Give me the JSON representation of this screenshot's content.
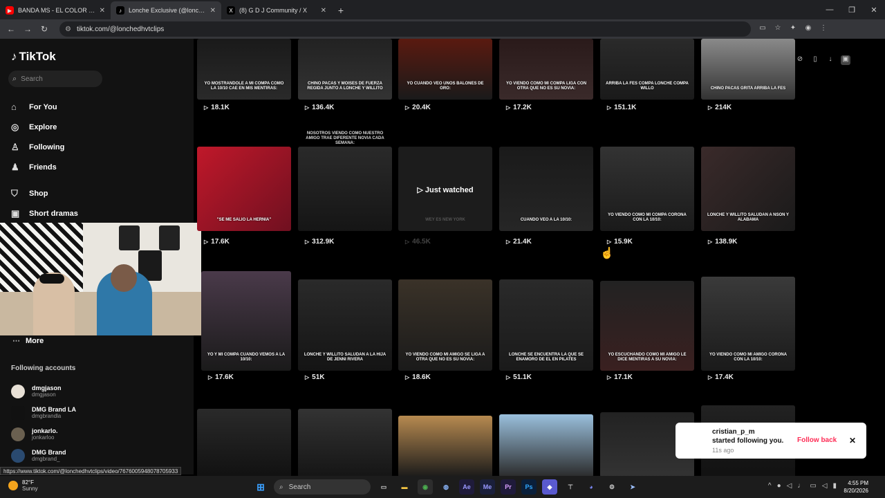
{
  "browser": {
    "tabs": [
      {
        "title": "BANDA MS - EL COLOR DE TUS",
        "favicon_color": "#ff0000"
      },
      {
        "title": "Lonche Exclusive (@lonchedhvtclips)",
        "favicon_color": "#000000"
      },
      {
        "title": "(8) G D J Community / X",
        "favicon_color": "#000000"
      }
    ],
    "url": "tiktok.com/@lonchedhvtclips"
  },
  "sidebar": {
    "logo": "TikTok",
    "search_placeholder": "Search",
    "menu": [
      {
        "label": "For You",
        "icon": "home-icon"
      },
      {
        "label": "Explore",
        "icon": "compass-icon"
      },
      {
        "label": "Following",
        "icon": "following-icon"
      },
      {
        "label": "Friends",
        "icon": "friends-icon"
      },
      {
        "label": "Shop",
        "icon": "shop-icon"
      },
      {
        "label": "Short dramas",
        "icon": "drama-icon"
      }
    ],
    "more": "More",
    "following_title": "Following accounts",
    "accounts": [
      {
        "name": "dmgjason",
        "handle": "dmgjason"
      },
      {
        "name": "DMG Brand LA",
        "handle": "dmgbrandla"
      },
      {
        "name": "jonkarlo.",
        "handle": "jonkarloo"
      },
      {
        "name": "DMG Brand",
        "handle": "dmgbrand_"
      }
    ]
  },
  "videos": {
    "row1": [
      {
        "caption": "YO MOSTRANDOLE A MI COMPA COMO LA 10/10 CAE EN MIS MENTIRAS:",
        "views": "18.1K"
      },
      {
        "caption": "CHINO PACAS Y MOISES DE FUERZA REGIDA JUNTO A LONCHE Y WILLITO",
        "views": "136.4K"
      },
      {
        "caption": "YO CUANDO VEO UNOS BALONES DE ORO:",
        "views": "20.4K"
      },
      {
        "caption": "YO VIENDO COMO MI COMPA LIGA CON OTRA QUE NO ES SU NOVIA:",
        "views": "17.2K"
      },
      {
        "caption": "ARRIBA LA FES COMPA LONCHE COMPA WILLO",
        "views": "151.1K"
      },
      {
        "caption": "CHINO PACAS GRITA ARRIBA LA FES",
        "views": "214K"
      }
    ],
    "row2": [
      {
        "caption": "\"SE ME SALIO LA HERNIA\"",
        "views": "17.6K"
      },
      {
        "caption": "NOSOTROS VIENDO COMO NUESTRO AMIGO TRAE DIFERENTE NOVIA CADA SEMANA:",
        "views": "312.9K"
      },
      {
        "caption": "WEY ES NEW YORK",
        "views": "46.5K",
        "watched": "Just watched"
      },
      {
        "caption": "CUANDO VEO A LA 10/10:",
        "views": "21.4K"
      },
      {
        "caption": "YO VIENDO COMO MI COMPA CORONA CON LA 10/10:",
        "views": "15.9K"
      },
      {
        "caption": "LONCHE Y WILLITO SALUDAN A NSON Y ALABAMA",
        "views": "138.9K"
      }
    ],
    "row3": [
      {
        "caption": "YO Y MI COMPA CUANDO VEMOS A LA 10/10:",
        "views": "17.6K"
      },
      {
        "caption": "LONCHE Y WILLITO SALUDAN A LA HIJA DE JENNI RIVERA",
        "views": "51K"
      },
      {
        "caption": "YO VIENDO COMO MI AMIGO SE LIGA A OTRA QUE NO ES SU NOVIA:",
        "views": "18.6K"
      },
      {
        "caption": "LONCHE SE ENCUENTRA LA QUE SE ENAMORO DE EL EN PILATES",
        "views": "51.1K"
      },
      {
        "caption": "YO ESCUCHANDO COMO MI AMIGO LE DICE MENTIRAS A SU NOVIA:",
        "views": "17.1K"
      },
      {
        "caption": "YO VIENDO COMO MI AMIGO CORONA CON LA 10/10:",
        "views": "17.4K"
      }
    ]
  },
  "notification": {
    "user": "cristian_p_m",
    "message": "started following you.",
    "time": "11s ago",
    "action": "Follow back"
  },
  "status_url": "https://www.tiktok.com/@lonchedhvtclips/video/7676005948078705933",
  "taskbar": {
    "temp": "82°F",
    "condition": "Sunny",
    "search": "Search",
    "time": "4:55 PM",
    "date": "8/20/2026"
  },
  "colors": {
    "accent": "#fe2c55",
    "background": "#000000"
  }
}
